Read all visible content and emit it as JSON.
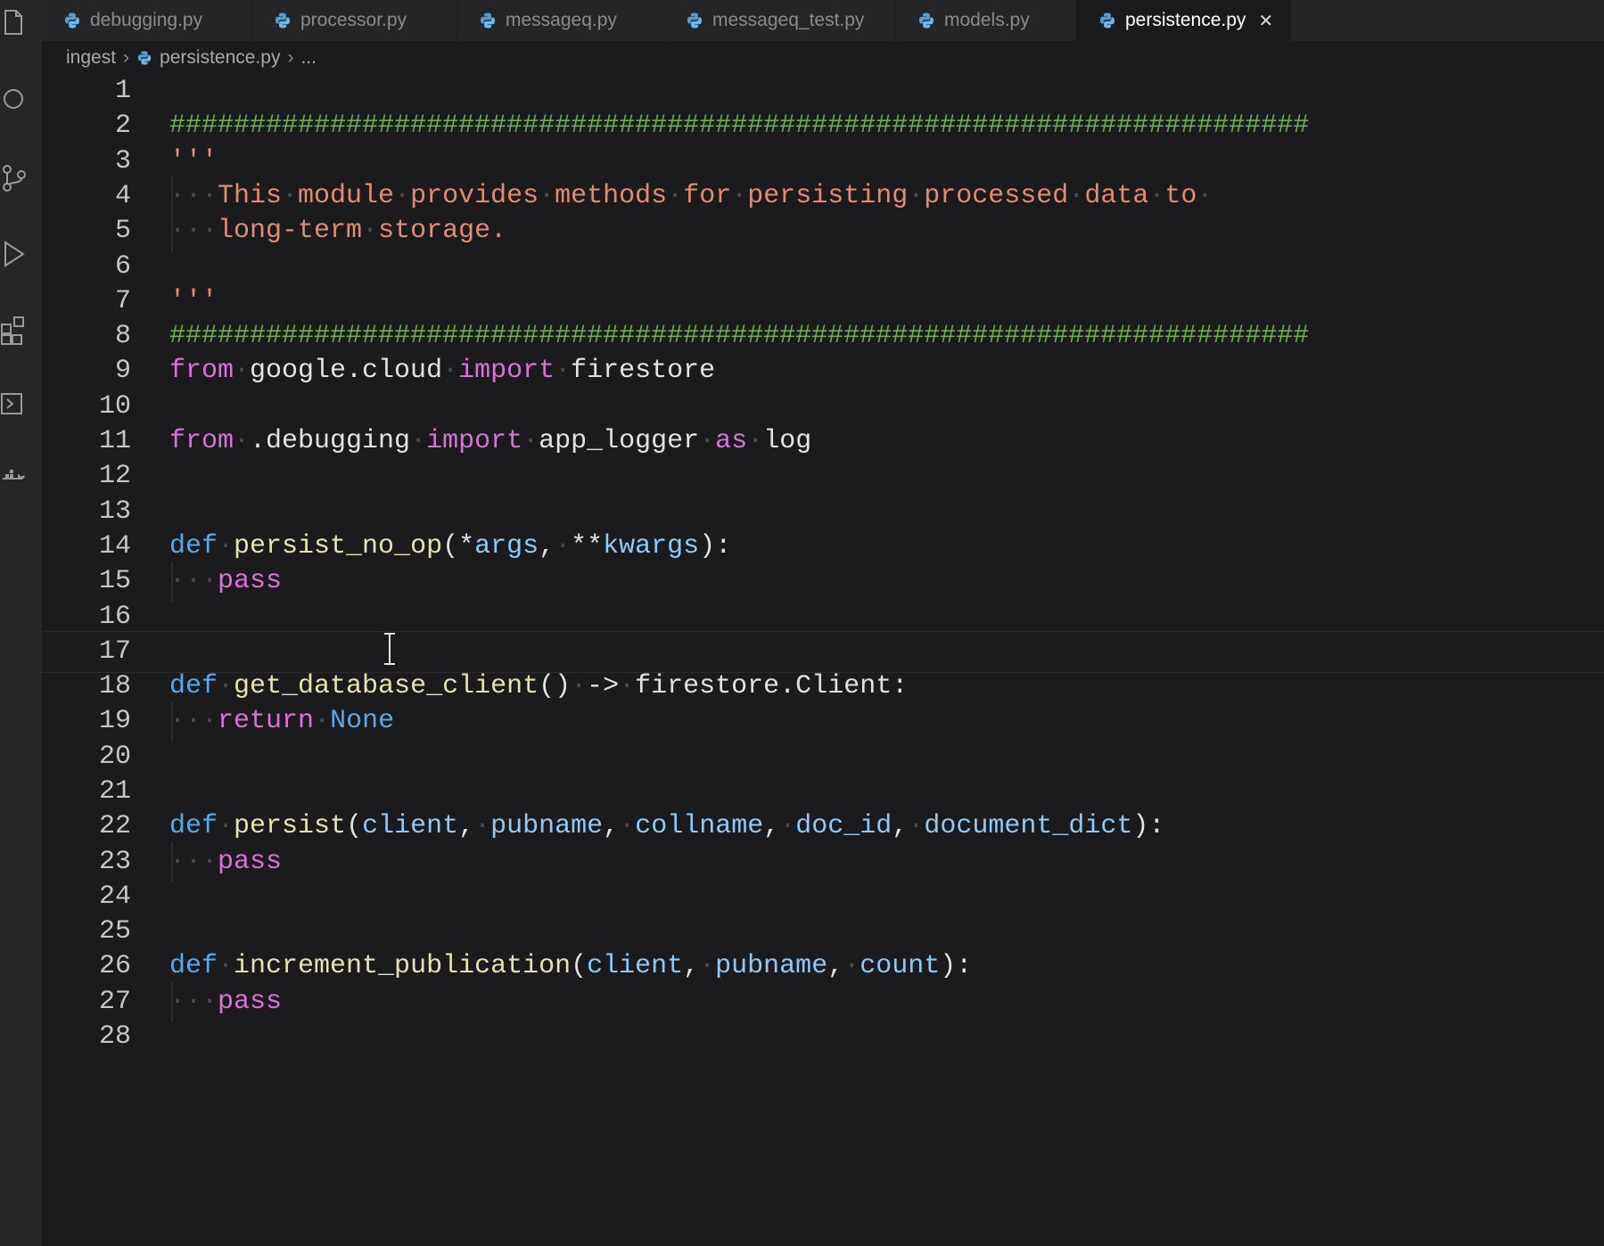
{
  "tabs": [
    {
      "label": "debugging.py",
      "active": false
    },
    {
      "label": "processor.py",
      "active": false
    },
    {
      "label": "messageq.py",
      "active": false
    },
    {
      "label": "messageq_test.py",
      "active": false
    },
    {
      "label": "models.py",
      "active": false
    },
    {
      "label": "persistence.py",
      "active": true
    }
  ],
  "breadcrumb": {
    "folder": "ingest",
    "file": "persistence.py",
    "more": "..."
  },
  "activity_icons": [
    "explorer-icon",
    "search-icon",
    "source-control-icon",
    "run-debug-icon",
    "extensions-icon",
    "remote-explorer-icon",
    "docker-icon"
  ],
  "colors": {
    "keyword_def": "#5aa9e6",
    "keyword_flow": "#d873d3",
    "function": "#e7e1b3",
    "parameter": "#8fc9f5",
    "string": "#e08b74",
    "comment": "#6ab04c"
  },
  "code": {
    "current_line": 17,
    "lines": [
      {
        "n": "1",
        "tokens": []
      },
      {
        "n": "2",
        "tokens": [
          {
            "t": "#######################################################################",
            "c": "cmt"
          }
        ]
      },
      {
        "n": "3",
        "tokens": [
          {
            "t": "'''",
            "c": "str"
          }
        ]
      },
      {
        "n": "4",
        "guide": true,
        "tokens": [
          {
            "t": "···",
            "c": "ws"
          },
          {
            "t": "This",
            "c": "str"
          },
          {
            "t": "·",
            "c": "ws"
          },
          {
            "t": "module",
            "c": "str"
          },
          {
            "t": "·",
            "c": "ws"
          },
          {
            "t": "provides",
            "c": "str"
          },
          {
            "t": "·",
            "c": "ws"
          },
          {
            "t": "methods",
            "c": "str"
          },
          {
            "t": "·",
            "c": "ws"
          },
          {
            "t": "for",
            "c": "str"
          },
          {
            "t": "·",
            "c": "ws"
          },
          {
            "t": "persisting",
            "c": "str"
          },
          {
            "t": "·",
            "c": "ws"
          },
          {
            "t": "processed",
            "c": "str"
          },
          {
            "t": "·",
            "c": "ws"
          },
          {
            "t": "data",
            "c": "str"
          },
          {
            "t": "·",
            "c": "ws"
          },
          {
            "t": "to",
            "c": "str"
          },
          {
            "t": "·",
            "c": "ws"
          }
        ]
      },
      {
        "n": "5",
        "guide": true,
        "tokens": [
          {
            "t": "···",
            "c": "ws"
          },
          {
            "t": "long-term",
            "c": "str"
          },
          {
            "t": "·",
            "c": "ws"
          },
          {
            "t": "storage.",
            "c": "str"
          }
        ]
      },
      {
        "n": "6",
        "tokens": []
      },
      {
        "n": "7",
        "tokens": [
          {
            "t": "'''",
            "c": "str"
          }
        ]
      },
      {
        "n": "8",
        "tokens": [
          {
            "t": "#######################################################################",
            "c": "cmt"
          }
        ]
      },
      {
        "n": "9",
        "tokens": [
          {
            "t": "from",
            "c": "kw-flow"
          },
          {
            "t": "·",
            "c": "ws"
          },
          {
            "t": "google.cloud",
            "c": "plain"
          },
          {
            "t": "·",
            "c": "ws"
          },
          {
            "t": "import",
            "c": "kw-flow"
          },
          {
            "t": "·",
            "c": "ws"
          },
          {
            "t": "firestore",
            "c": "plain"
          }
        ]
      },
      {
        "n": "10",
        "tokens": []
      },
      {
        "n": "11",
        "tokens": [
          {
            "t": "from",
            "c": "kw-flow"
          },
          {
            "t": "·",
            "c": "ws"
          },
          {
            "t": ".debugging",
            "c": "plain"
          },
          {
            "t": "·",
            "c": "ws"
          },
          {
            "t": "import",
            "c": "kw-flow"
          },
          {
            "t": "·",
            "c": "ws"
          },
          {
            "t": "app_logger",
            "c": "plain"
          },
          {
            "t": "·",
            "c": "ws"
          },
          {
            "t": "as",
            "c": "kw-flow"
          },
          {
            "t": "·",
            "c": "ws"
          },
          {
            "t": "log",
            "c": "plain"
          }
        ]
      },
      {
        "n": "12",
        "tokens": []
      },
      {
        "n": "13",
        "tokens": []
      },
      {
        "n": "14",
        "tokens": [
          {
            "t": "def",
            "c": "kw-def"
          },
          {
            "t": "·",
            "c": "ws"
          },
          {
            "t": "persist_no_op",
            "c": "fn"
          },
          {
            "t": "(*",
            "c": "plain"
          },
          {
            "t": "args",
            "c": "param"
          },
          {
            "t": ",",
            "c": "plain"
          },
          {
            "t": "·",
            "c": "ws"
          },
          {
            "t": "**",
            "c": "plain"
          },
          {
            "t": "kwargs",
            "c": "param"
          },
          {
            "t": "):",
            "c": "plain"
          }
        ]
      },
      {
        "n": "15",
        "guide": true,
        "tokens": [
          {
            "t": "···",
            "c": "ws"
          },
          {
            "t": "pass",
            "c": "kw-flow"
          }
        ]
      },
      {
        "n": "16",
        "tokens": []
      },
      {
        "n": "17",
        "tokens": []
      },
      {
        "n": "18",
        "tokens": [
          {
            "t": "def",
            "c": "kw-def"
          },
          {
            "t": "·",
            "c": "ws"
          },
          {
            "t": "get_database_client",
            "c": "fn"
          },
          {
            "t": "()",
            "c": "plain"
          },
          {
            "t": "·",
            "c": "ws"
          },
          {
            "t": "->",
            "c": "plain"
          },
          {
            "t": "·",
            "c": "ws"
          },
          {
            "t": "firestore.Client:",
            "c": "plain"
          }
        ]
      },
      {
        "n": "19",
        "guide": true,
        "tokens": [
          {
            "t": "···",
            "c": "ws"
          },
          {
            "t": "return",
            "c": "kw-flow"
          },
          {
            "t": "·",
            "c": "ws"
          },
          {
            "t": "None",
            "c": "const"
          }
        ]
      },
      {
        "n": "20",
        "tokens": []
      },
      {
        "n": "21",
        "tokens": []
      },
      {
        "n": "22",
        "tokens": [
          {
            "t": "def",
            "c": "kw-def"
          },
          {
            "t": "·",
            "c": "ws"
          },
          {
            "t": "persist",
            "c": "fn"
          },
          {
            "t": "(",
            "c": "plain"
          },
          {
            "t": "client",
            "c": "param"
          },
          {
            "t": ",",
            "c": "plain"
          },
          {
            "t": "·",
            "c": "ws"
          },
          {
            "t": "pubname",
            "c": "param"
          },
          {
            "t": ",",
            "c": "plain"
          },
          {
            "t": "·",
            "c": "ws"
          },
          {
            "t": "collname",
            "c": "param"
          },
          {
            "t": ",",
            "c": "plain"
          },
          {
            "t": "·",
            "c": "ws"
          },
          {
            "t": "doc_id",
            "c": "param"
          },
          {
            "t": ",",
            "c": "plain"
          },
          {
            "t": "·",
            "c": "ws"
          },
          {
            "t": "document_dict",
            "c": "param"
          },
          {
            "t": "):",
            "c": "plain"
          }
        ]
      },
      {
        "n": "23",
        "guide": true,
        "tokens": [
          {
            "t": "···",
            "c": "ws"
          },
          {
            "t": "pass",
            "c": "kw-flow"
          }
        ]
      },
      {
        "n": "24",
        "tokens": []
      },
      {
        "n": "25",
        "tokens": []
      },
      {
        "n": "26",
        "tokens": [
          {
            "t": "def",
            "c": "kw-def"
          },
          {
            "t": "·",
            "c": "ws"
          },
          {
            "t": "increment_publication",
            "c": "fn"
          },
          {
            "t": "(",
            "c": "plain"
          },
          {
            "t": "client",
            "c": "param"
          },
          {
            "t": ",",
            "c": "plain"
          },
          {
            "t": "·",
            "c": "ws"
          },
          {
            "t": "pubname",
            "c": "param"
          },
          {
            "t": ",",
            "c": "plain"
          },
          {
            "t": "·",
            "c": "ws"
          },
          {
            "t": "count",
            "c": "param"
          },
          {
            "t": "):",
            "c": "plain"
          }
        ]
      },
      {
        "n": "27",
        "guide": true,
        "tokens": [
          {
            "t": "···",
            "c": "ws"
          },
          {
            "t": "pass",
            "c": "kw-flow"
          }
        ]
      },
      {
        "n": "28",
        "tokens": []
      }
    ]
  }
}
